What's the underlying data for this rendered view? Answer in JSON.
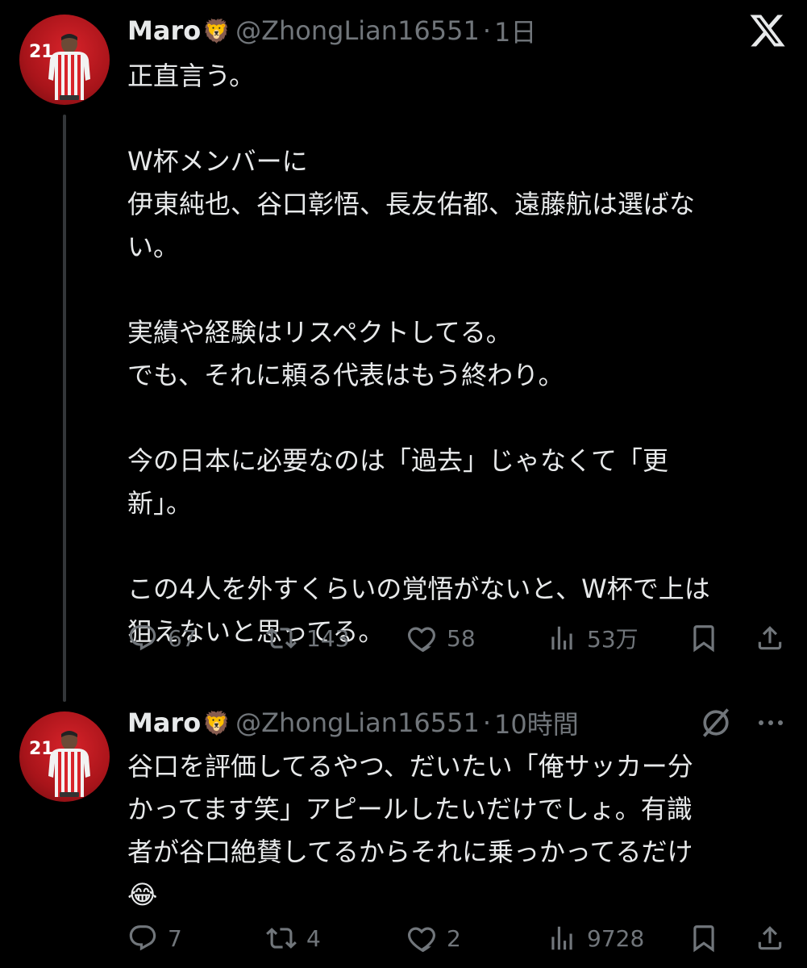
{
  "tweets": [
    {
      "name": "Maro",
      "emoji": "🦁",
      "handle": "@ZhongLian16551",
      "separator": "·",
      "time": "1日",
      "avatar_number": "21",
      "text_lines": [
        "正直言う。",
        "",
        "W杯メンバーに",
        "伊東純也、谷口彰悟、長友佑都、遠藤航は選ばな",
        "い。",
        "",
        "実績や経験はリスペクトしてる。",
        "でも、それに頼る代表はもう終わり。",
        "",
        "今の日本に必要なのは「過去」じゃなくて「更",
        "新」。",
        "",
        "この4人を外すくらいの覚悟がないと、W杯で上は",
        "狙えないと思ってる。"
      ],
      "replies": "67",
      "reposts": "143",
      "likes": "58",
      "views": "53万"
    },
    {
      "name": "Maro",
      "emoji": "🦁",
      "handle": "@ZhongLian16551",
      "separator": "·",
      "time": "10時間",
      "avatar_number": "21",
      "text_lines": [
        "谷口を評価してるやつ、だいたい「俺サッカー分",
        "かってます笑」アピールしたいだけでしょ。有識",
        "者が谷口絶賛してるからそれに乗っかってるだけ",
        "😂"
      ],
      "replies": "7",
      "reposts": "4",
      "likes": "2",
      "views": "9728"
    }
  ],
  "icons": {
    "brand": "x-logo-icon",
    "reply": "reply-icon",
    "repost": "repost-icon",
    "like": "heart-icon",
    "views": "views-icon",
    "bookmark": "bookmark-icon",
    "share": "share-icon",
    "mute": "grok-icon",
    "more": "more-icon"
  },
  "colors": {
    "background": "#000000",
    "text": "#e7e9ea",
    "secondary": "#71767b",
    "thread_line": "#333639",
    "avatar_red": "#d8232a"
  }
}
